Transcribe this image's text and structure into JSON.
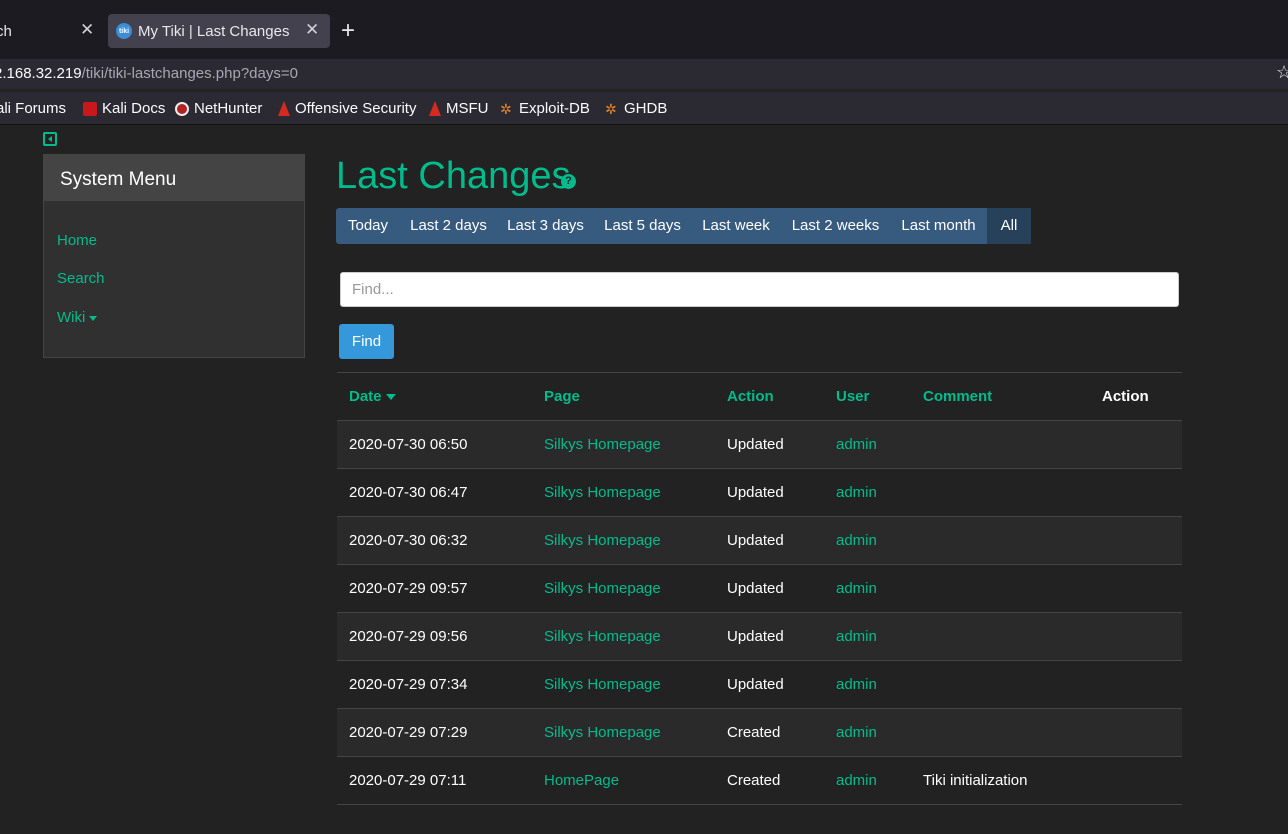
{
  "browser": {
    "tabs": [
      {
        "title": "ch"
      },
      {
        "title": "My Tiki | Last Changes",
        "favicon": "tiki"
      }
    ],
    "url": {
      "host": "2.168.32.219",
      "path": "/tiki/tiki-lastchanges.php?days=0"
    },
    "bookmarks": [
      {
        "label": "ali Forums"
      },
      {
        "label": "Kali Docs"
      },
      {
        "label": "NetHunter"
      },
      {
        "label": "Offensive Security"
      },
      {
        "label": "MSFU"
      },
      {
        "label": "Exploit-DB"
      },
      {
        "label": "GHDB"
      }
    ]
  },
  "sidebar": {
    "title": "System Menu",
    "items": [
      {
        "label": "Home"
      },
      {
        "label": "Search"
      },
      {
        "label": "Wiki"
      }
    ]
  },
  "main": {
    "title": "Last Changes",
    "help": "?",
    "periods": [
      "Today",
      "Last 2 days",
      "Last 3 days",
      "Last 5 days",
      "Last week",
      "Last 2 weeks",
      "Last month",
      "All"
    ],
    "active_period": "All",
    "search": {
      "placeholder": "Find...",
      "value": "",
      "button": "Find"
    },
    "table": {
      "headers": [
        "Date",
        "Page",
        "Action",
        "User",
        "Comment",
        "Action"
      ],
      "rows": [
        [
          "2020-07-30 06:50",
          "Silkys Homepage",
          "Updated",
          "admin",
          ""
        ],
        [
          "2020-07-30 06:47",
          "Silkys Homepage",
          "Updated",
          "admin",
          ""
        ],
        [
          "2020-07-30 06:32",
          "Silkys Homepage",
          "Updated",
          "admin",
          ""
        ],
        [
          "2020-07-29 09:57",
          "Silkys Homepage",
          "Updated",
          "admin",
          ""
        ],
        [
          "2020-07-29 09:56",
          "Silkys Homepage",
          "Updated",
          "admin",
          ""
        ],
        [
          "2020-07-29 07:34",
          "Silkys Homepage",
          "Updated",
          "admin",
          ""
        ],
        [
          "2020-07-29 07:29",
          "Silkys Homepage",
          "Created",
          "admin",
          ""
        ],
        [
          "2020-07-29 07:11",
          "HomePage",
          "Created",
          "admin",
          "Tiki initialization"
        ]
      ]
    }
  },
  "colors": {
    "accent": "#00bc8c",
    "nav": "#375a7f",
    "nav_active": "#28415b",
    "button": "#3498db",
    "background": "#222222"
  }
}
